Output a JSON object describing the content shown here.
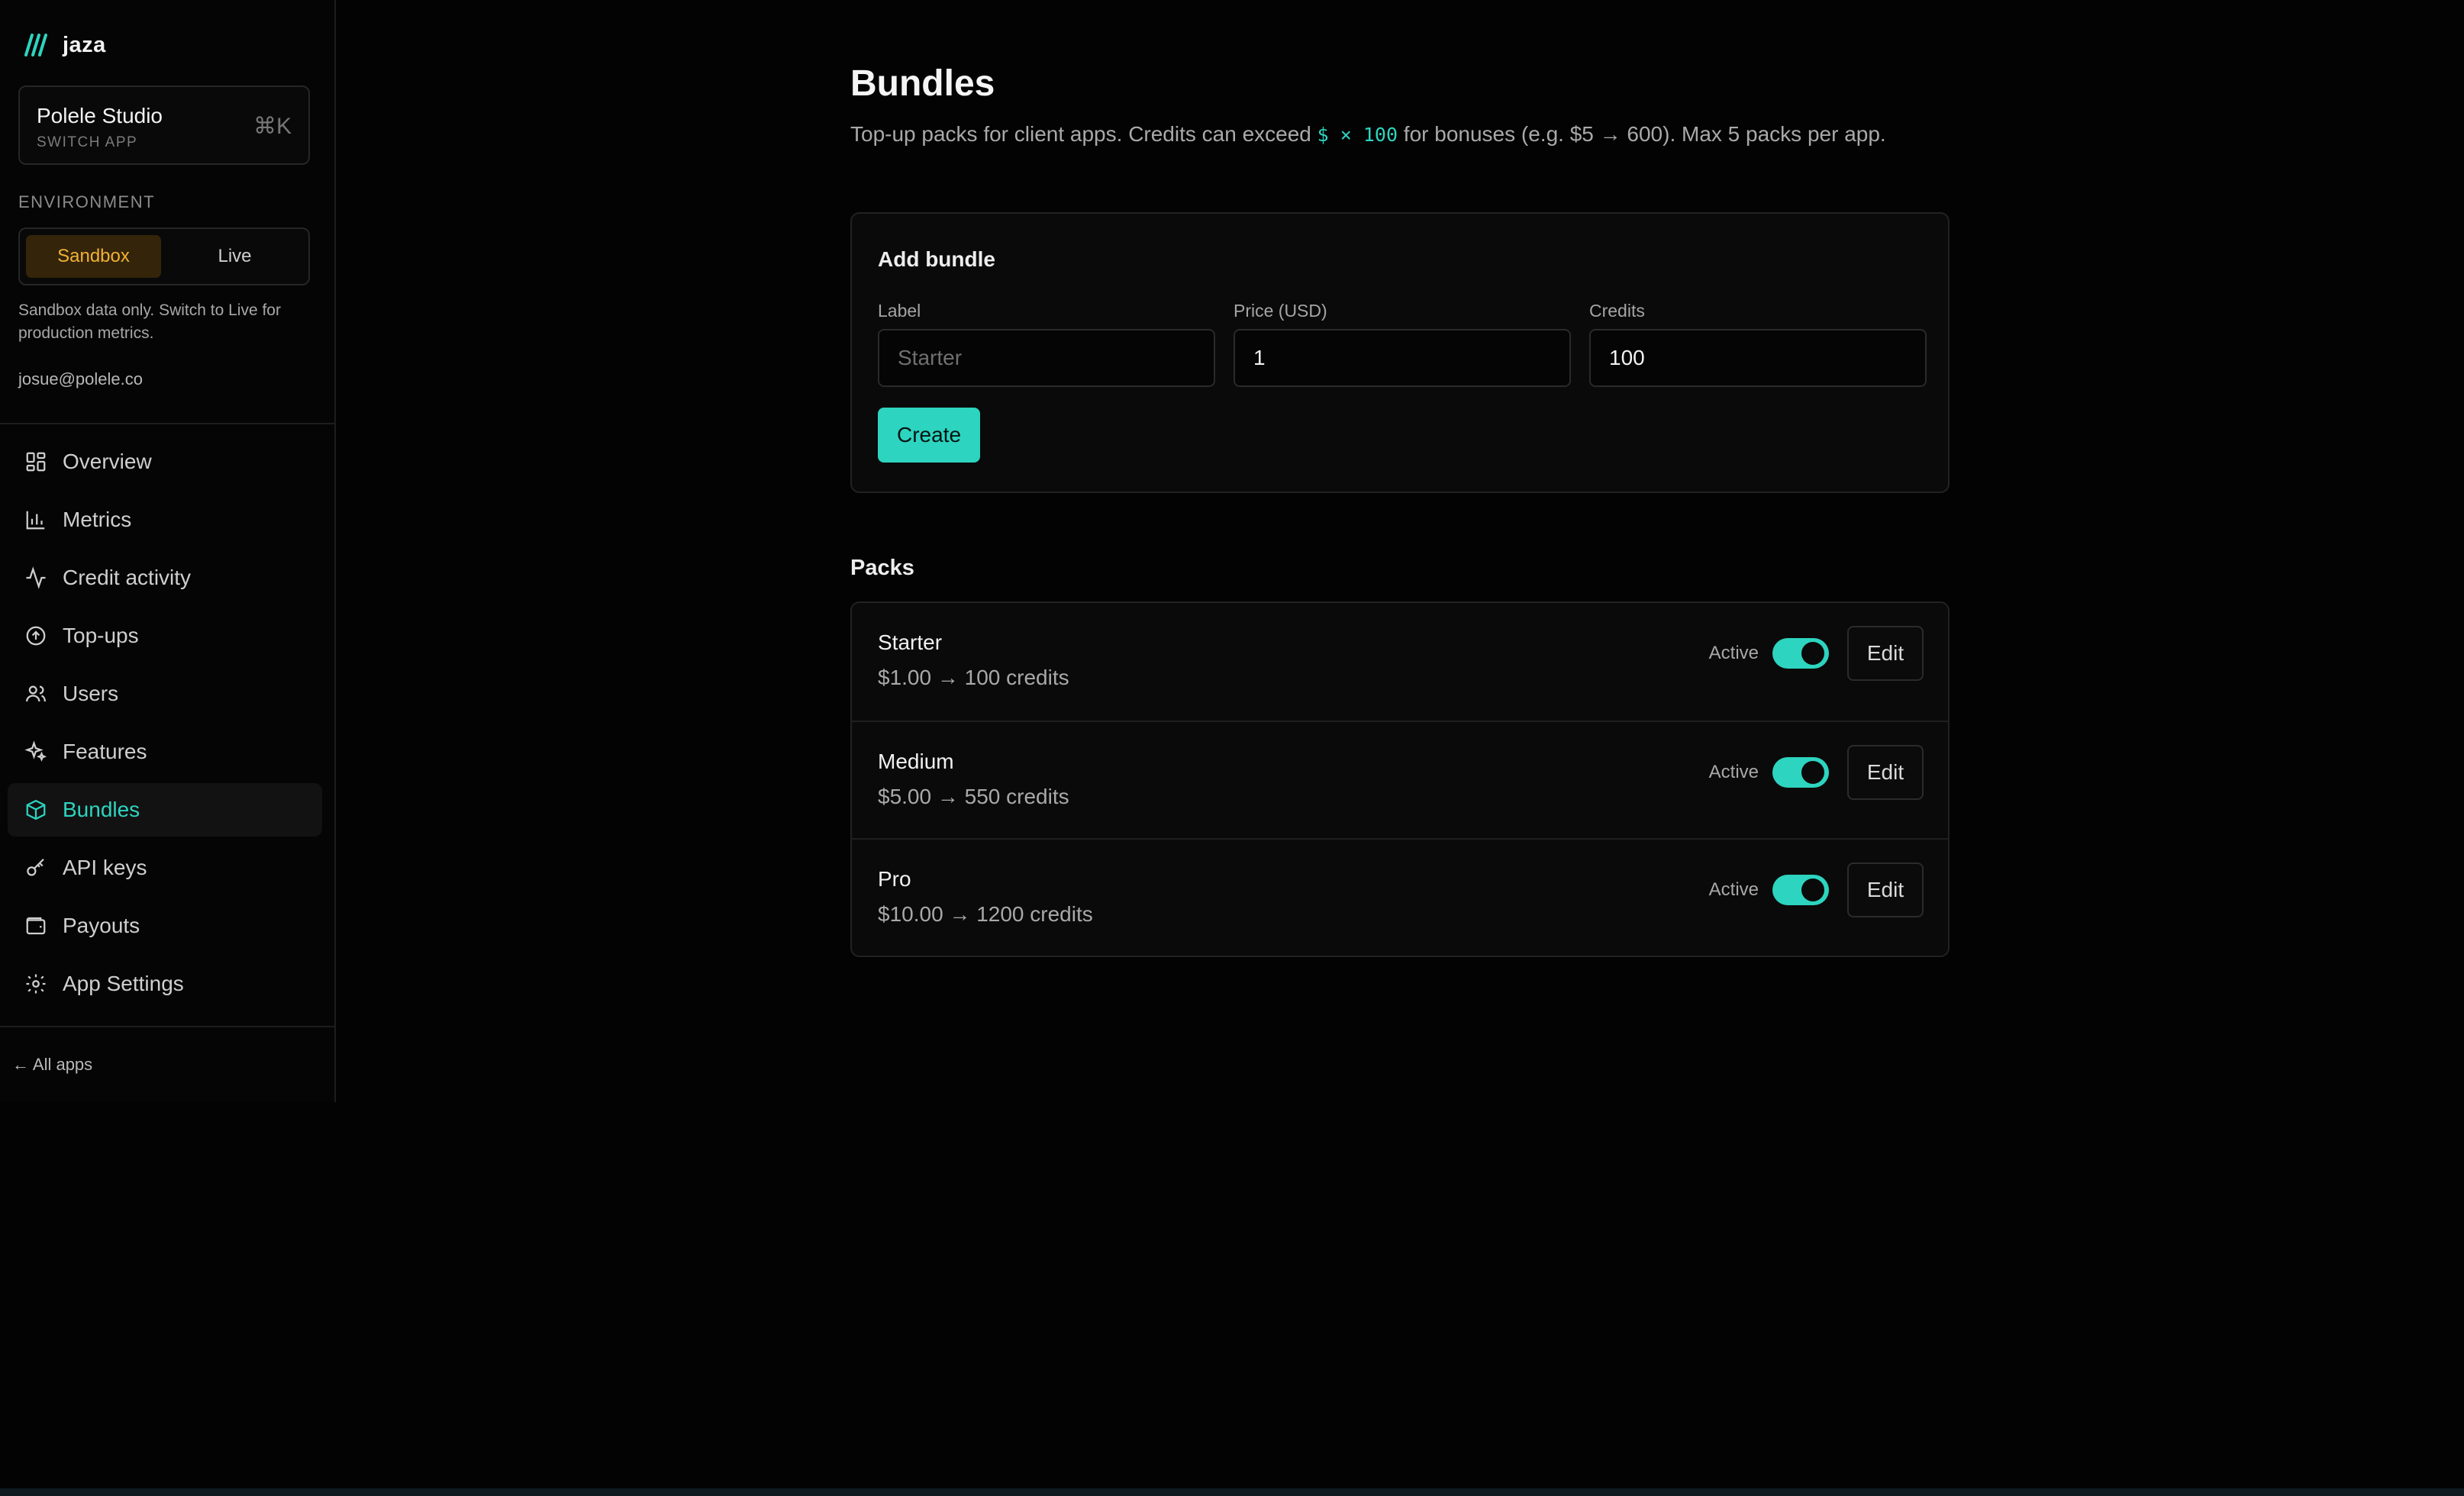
{
  "brand": {
    "name": "jaza"
  },
  "app_switcher": {
    "name": "Polele Studio",
    "subtitle": "SWITCH APP",
    "shortcut": "⌘K"
  },
  "environment": {
    "label": "ENVIRONMENT",
    "options": [
      "Sandbox",
      "Live"
    ],
    "selected": "Sandbox",
    "note": "Sandbox data only. Switch to Live for production metrics."
  },
  "user": {
    "email": "josue@polele.co"
  },
  "nav": {
    "items": [
      {
        "label": "Overview",
        "icon": "dashboard-icon"
      },
      {
        "label": "Metrics",
        "icon": "bar-chart-icon"
      },
      {
        "label": "Credit activity",
        "icon": "activity-icon"
      },
      {
        "label": "Top-ups",
        "icon": "arrow-up-circle-icon"
      },
      {
        "label": "Users",
        "icon": "users-icon"
      },
      {
        "label": "Features",
        "icon": "sparkles-icon"
      },
      {
        "label": "Bundles",
        "icon": "package-icon",
        "active": true
      },
      {
        "label": "API keys",
        "icon": "key-icon"
      },
      {
        "label": "Payouts",
        "icon": "wallet-icon"
      },
      {
        "label": "App Settings",
        "icon": "gear-icon"
      }
    ],
    "all_apps": "← All apps"
  },
  "page": {
    "title": "Bundles",
    "subtitle_before": "Top-up packs for client apps. Credits can exceed ",
    "subtitle_code": "$ × 100",
    "subtitle_after": " for bonuses (e.g. $5 → 600). Max 5 packs per app."
  },
  "add_bundle": {
    "title": "Add bundle",
    "label_field": {
      "label": "Label",
      "value": "",
      "placeholder": "Starter"
    },
    "price_field": {
      "label": "Price (USD)",
      "value": "1"
    },
    "credits_field": {
      "label": "Credits",
      "value": "100"
    },
    "create_label": "Create"
  },
  "packs": {
    "title": "Packs",
    "items": [
      {
        "name": "Starter",
        "price": "$1.00 → 100 credits",
        "status": "Active",
        "active": true,
        "edit": "Edit"
      },
      {
        "name": "Medium",
        "price": "$5.00 → 550 credits",
        "status": "Active",
        "active": true,
        "edit": "Edit"
      },
      {
        "name": "Pro",
        "price": "$10.00 → 1200 credits",
        "status": "Active",
        "active": true,
        "edit": "Edit"
      }
    ]
  },
  "colors": {
    "accent": "#2dd4bf",
    "sandbox": "#f2b134",
    "background": "#030303"
  }
}
